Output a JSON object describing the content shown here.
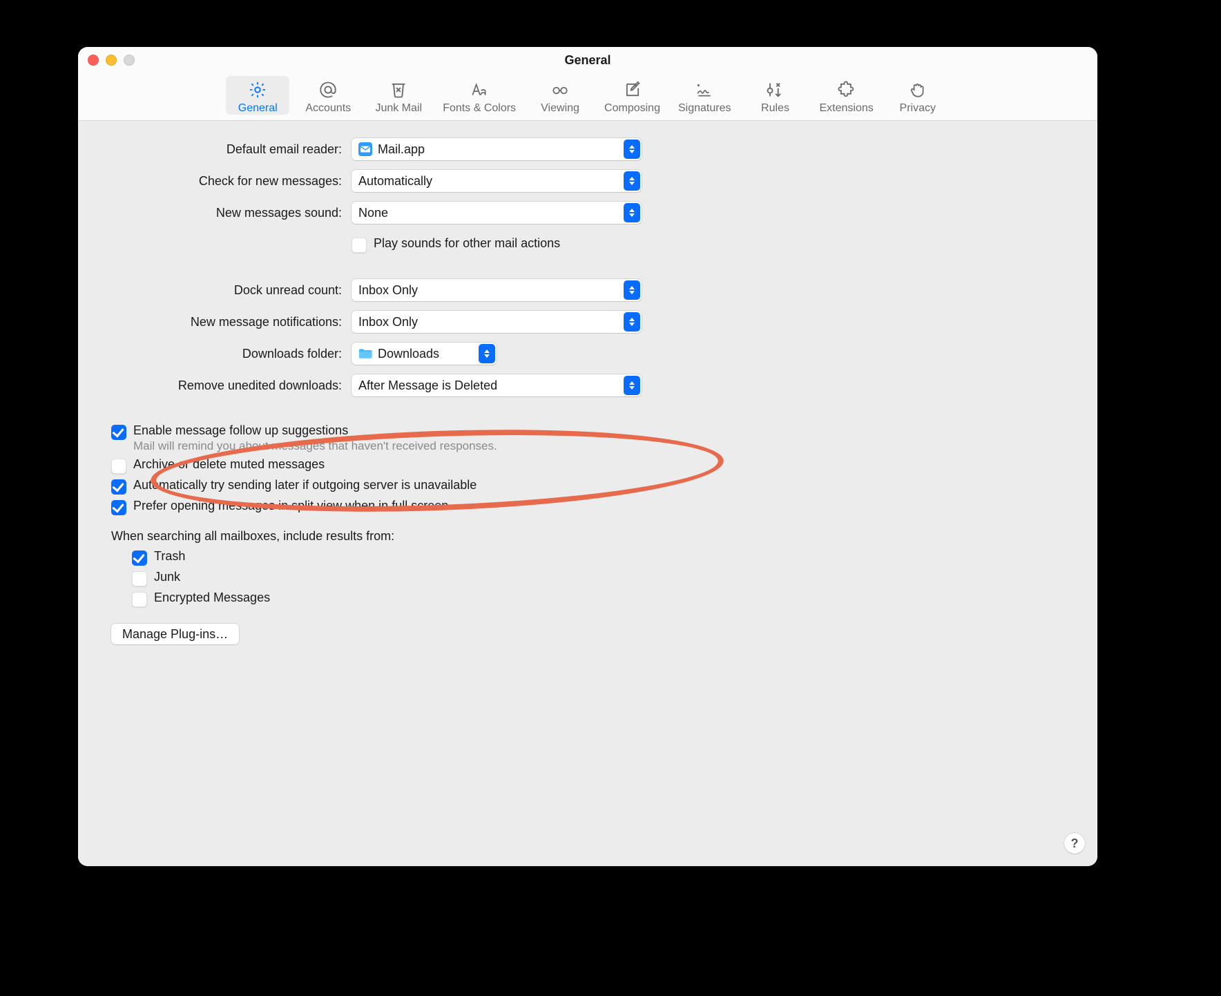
{
  "window": {
    "title": "General"
  },
  "toolbar": {
    "items": [
      {
        "label": "General"
      },
      {
        "label": "Accounts"
      },
      {
        "label": "Junk Mail"
      },
      {
        "label": "Fonts & Colors"
      },
      {
        "label": "Viewing"
      },
      {
        "label": "Composing"
      },
      {
        "label": "Signatures"
      },
      {
        "label": "Rules"
      },
      {
        "label": "Extensions"
      },
      {
        "label": "Privacy"
      }
    ]
  },
  "labels": {
    "defaultReader": "Default email reader:",
    "checkNew": "Check for new messages:",
    "newSound": "New messages sound:",
    "playSounds": "Play sounds for other mail actions",
    "dockCount": "Dock unread count:",
    "notifications": "New message notifications:",
    "downloadsFolder": "Downloads folder:",
    "removeDownloads": "Remove unedited downloads:",
    "followUp": "Enable message follow up suggestions",
    "followUpSub": "Mail will remind you about messages that haven't received responses.",
    "archiveMuted": "Archive or delete muted messages",
    "retrySend": "Automatically try sending later if outgoing server is unavailable",
    "splitView": "Prefer opening messages in split view when in full screen",
    "searchIntro": "When searching all mailboxes, include results from:",
    "trash": "Trash",
    "junk": "Junk",
    "encrypted": "Encrypted Messages",
    "managePlugins": "Manage Plug-ins…",
    "help": "?"
  },
  "values": {
    "defaultReader": "Mail.app",
    "checkNew": "Automatically",
    "newSound": "None",
    "dockCount": "Inbox Only",
    "notifications": "Inbox Only",
    "downloadsFolder": "Downloads",
    "removeDownloads": "After Message is Deleted"
  },
  "checks": {
    "playSounds": false,
    "followUp": true,
    "archiveMuted": false,
    "retrySend": true,
    "splitView": true,
    "trash": true,
    "junk": false,
    "encrypted": false
  }
}
